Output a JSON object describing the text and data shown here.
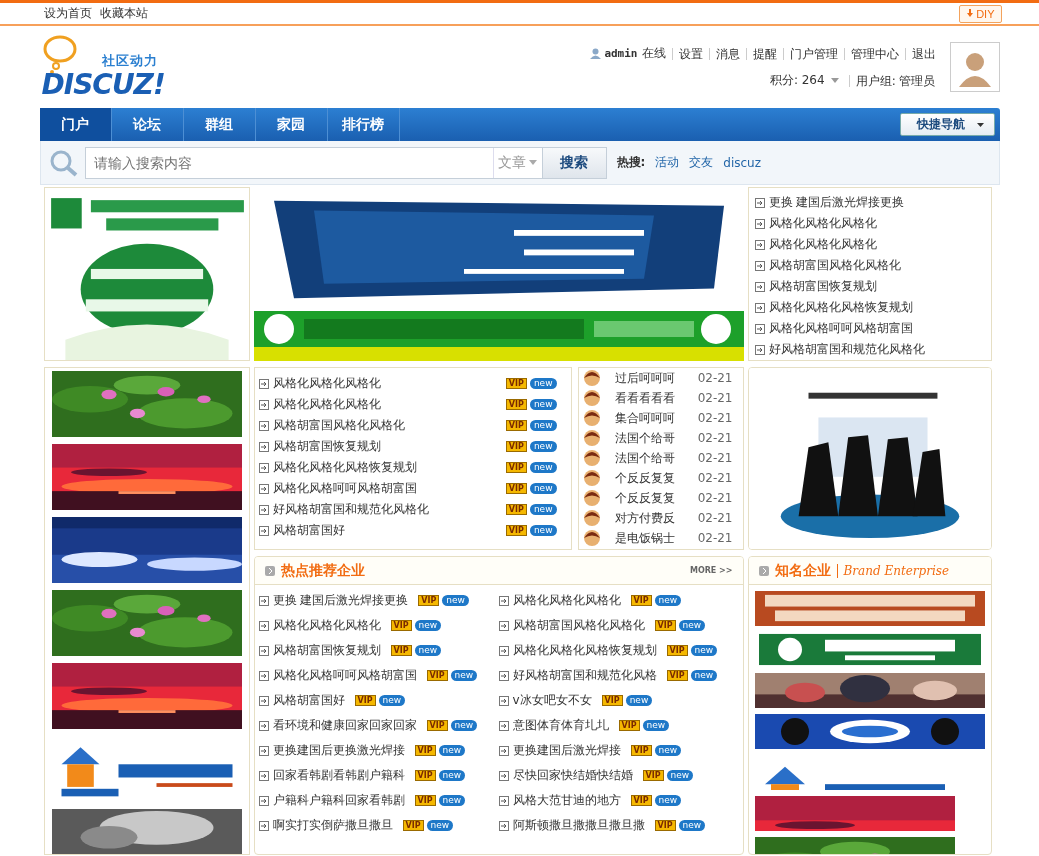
{
  "top_bar": {
    "links": [
      "设为首页",
      "收藏本站"
    ],
    "diy_button": "DIY"
  },
  "logo": {
    "tagline": "社区动力",
    "name": "DISCUZ!"
  },
  "user_bar": {
    "username": "admin",
    "status": "在线",
    "links": [
      "设置",
      "消息",
      "提醒",
      "门户管理",
      "管理中心",
      "退出"
    ],
    "points": "积分: 264",
    "group": "用户组: 管理员"
  },
  "nav": {
    "items": [
      {
        "label": "门户",
        "selected": true
      },
      {
        "label": "论坛",
        "selected": false
      },
      {
        "label": "群组",
        "selected": false
      },
      {
        "label": "家园",
        "selected": false
      },
      {
        "label": "排行榜",
        "selected": false
      }
    ],
    "quick_nav": "快捷导航"
  },
  "search": {
    "placeholder": "请输入搜索内容",
    "type": "文章",
    "button": "搜索",
    "hot_label": "热搜:",
    "hot": [
      "活动",
      "交友",
      "discuz"
    ]
  },
  "news_list": [
    "更换 建国后激光焊接更换",
    "风格化风格化风格化",
    "风格化风格化风格化",
    "风格胡富国风格化风格化",
    "风格胡富国恢复规划",
    "风格化风格化风格恢复规划",
    "风格化风格呵呵风格胡富国",
    "好风格胡富国和规范化风格化"
  ],
  "vip_list": [
    {
      "title": "风格化风格化风格化",
      "badges": [
        "VIP",
        "new"
      ]
    },
    {
      "title": "风格化风格化风格化",
      "badges": [
        "VIP",
        "new"
      ]
    },
    {
      "title": "风格胡富国风格化风格化",
      "badges": [
        "VIP",
        "new"
      ]
    },
    {
      "title": "风格胡富国恢复规划",
      "badges": [
        "VIP",
        "new"
      ]
    },
    {
      "title": "风格化风格化风格恢复规划",
      "badges": [
        "VIP",
        "new"
      ]
    },
    {
      "title": "风格化风格呵呵风格胡富国",
      "badges": [
        "VIP",
        "new"
      ]
    },
    {
      "title": "好风格胡富国和规范化风格化",
      "badges": [
        "VIP",
        "new"
      ]
    },
    {
      "title": "风格胡富国好",
      "badges": [
        "VIP",
        "new"
      ]
    }
  ],
  "date_list": [
    {
      "title": "过后呵呵呵",
      "date": "02-21"
    },
    {
      "title": "看看看看看",
      "date": "02-21"
    },
    {
      "title": "集合呵呵呵",
      "date": "02-21"
    },
    {
      "title": "法国个给哥",
      "date": "02-21"
    },
    {
      "title": "法国个给哥",
      "date": "02-21"
    },
    {
      "title": "个反反复复",
      "date": "02-21"
    },
    {
      "title": "个反反复复",
      "date": "02-21"
    },
    {
      "title": "对方付费反",
      "date": "02-21"
    },
    {
      "title": "是电饭锅士",
      "date": "02-21"
    }
  ],
  "hot_companies": {
    "title": "热点推荐企业",
    "more": "MORE >>",
    "items": [
      {
        "title": "更换 建国后激光焊接更换",
        "badges": [
          "VIP",
          "new"
        ]
      },
      {
        "title": "风格化风格化风格化",
        "badges": [
          "VIP",
          "new"
        ]
      },
      {
        "title": "风格化风格化风格化",
        "badges": [
          "VIP",
          "new"
        ]
      },
      {
        "title": "风格胡富国风格化风格化",
        "badges": [
          "VIP",
          "new"
        ]
      },
      {
        "title": "风格胡富国恢复规划",
        "badges": [
          "VIP",
          "new"
        ]
      },
      {
        "title": "风格化风格化风格恢复规划",
        "badges": [
          "VIP",
          "new"
        ]
      },
      {
        "title": "风格化风格呵呵风格胡富国",
        "badges": [
          "VIP",
          "new"
        ]
      },
      {
        "title": "好风格胡富国和规范化风格",
        "badges": [
          "VIP",
          "new"
        ]
      },
      {
        "title": "风格胡富国好",
        "badges": [
          "VIP",
          "new"
        ]
      },
      {
        "title": "v冰女吧女不女",
        "badges": [
          "VIP",
          "new"
        ]
      },
      {
        "title": "看环境和健康回家回家回家",
        "badges": [
          "VIP",
          "new"
        ]
      },
      {
        "title": "意图体育体育圠圠",
        "badges": [
          "VIP",
          "new"
        ]
      },
      {
        "title": "更换建国后更换激光焊接",
        "badges": [
          "VIP",
          "new"
        ]
      },
      {
        "title": "更换建国后激光焊接",
        "badges": [
          "VIP",
          "new"
        ]
      },
      {
        "title": "回家看韩剧看韩剧户籍科",
        "badges": [
          "VIP",
          "new"
        ]
      },
      {
        "title": "尽快回家快结婚快结婚",
        "badges": [
          "VIP",
          "new"
        ]
      },
      {
        "title": "户籍科户籍科回家看韩剧",
        "badges": [
          "VIP",
          "new"
        ]
      },
      {
        "title": "风格大范甘迪的地方",
        "badges": [
          "VIP",
          "new"
        ]
      },
      {
        "title": "啊实打实倒萨撒旦撒旦",
        "badges": [
          "VIP",
          "new"
        ]
      },
      {
        "title": "阿斯顿撒旦撒撒旦撒旦撒",
        "badges": [
          "VIP",
          "new"
        ]
      }
    ]
  },
  "famous": {
    "title": "知名企业",
    "subtitle": "Brand Enterprise"
  }
}
